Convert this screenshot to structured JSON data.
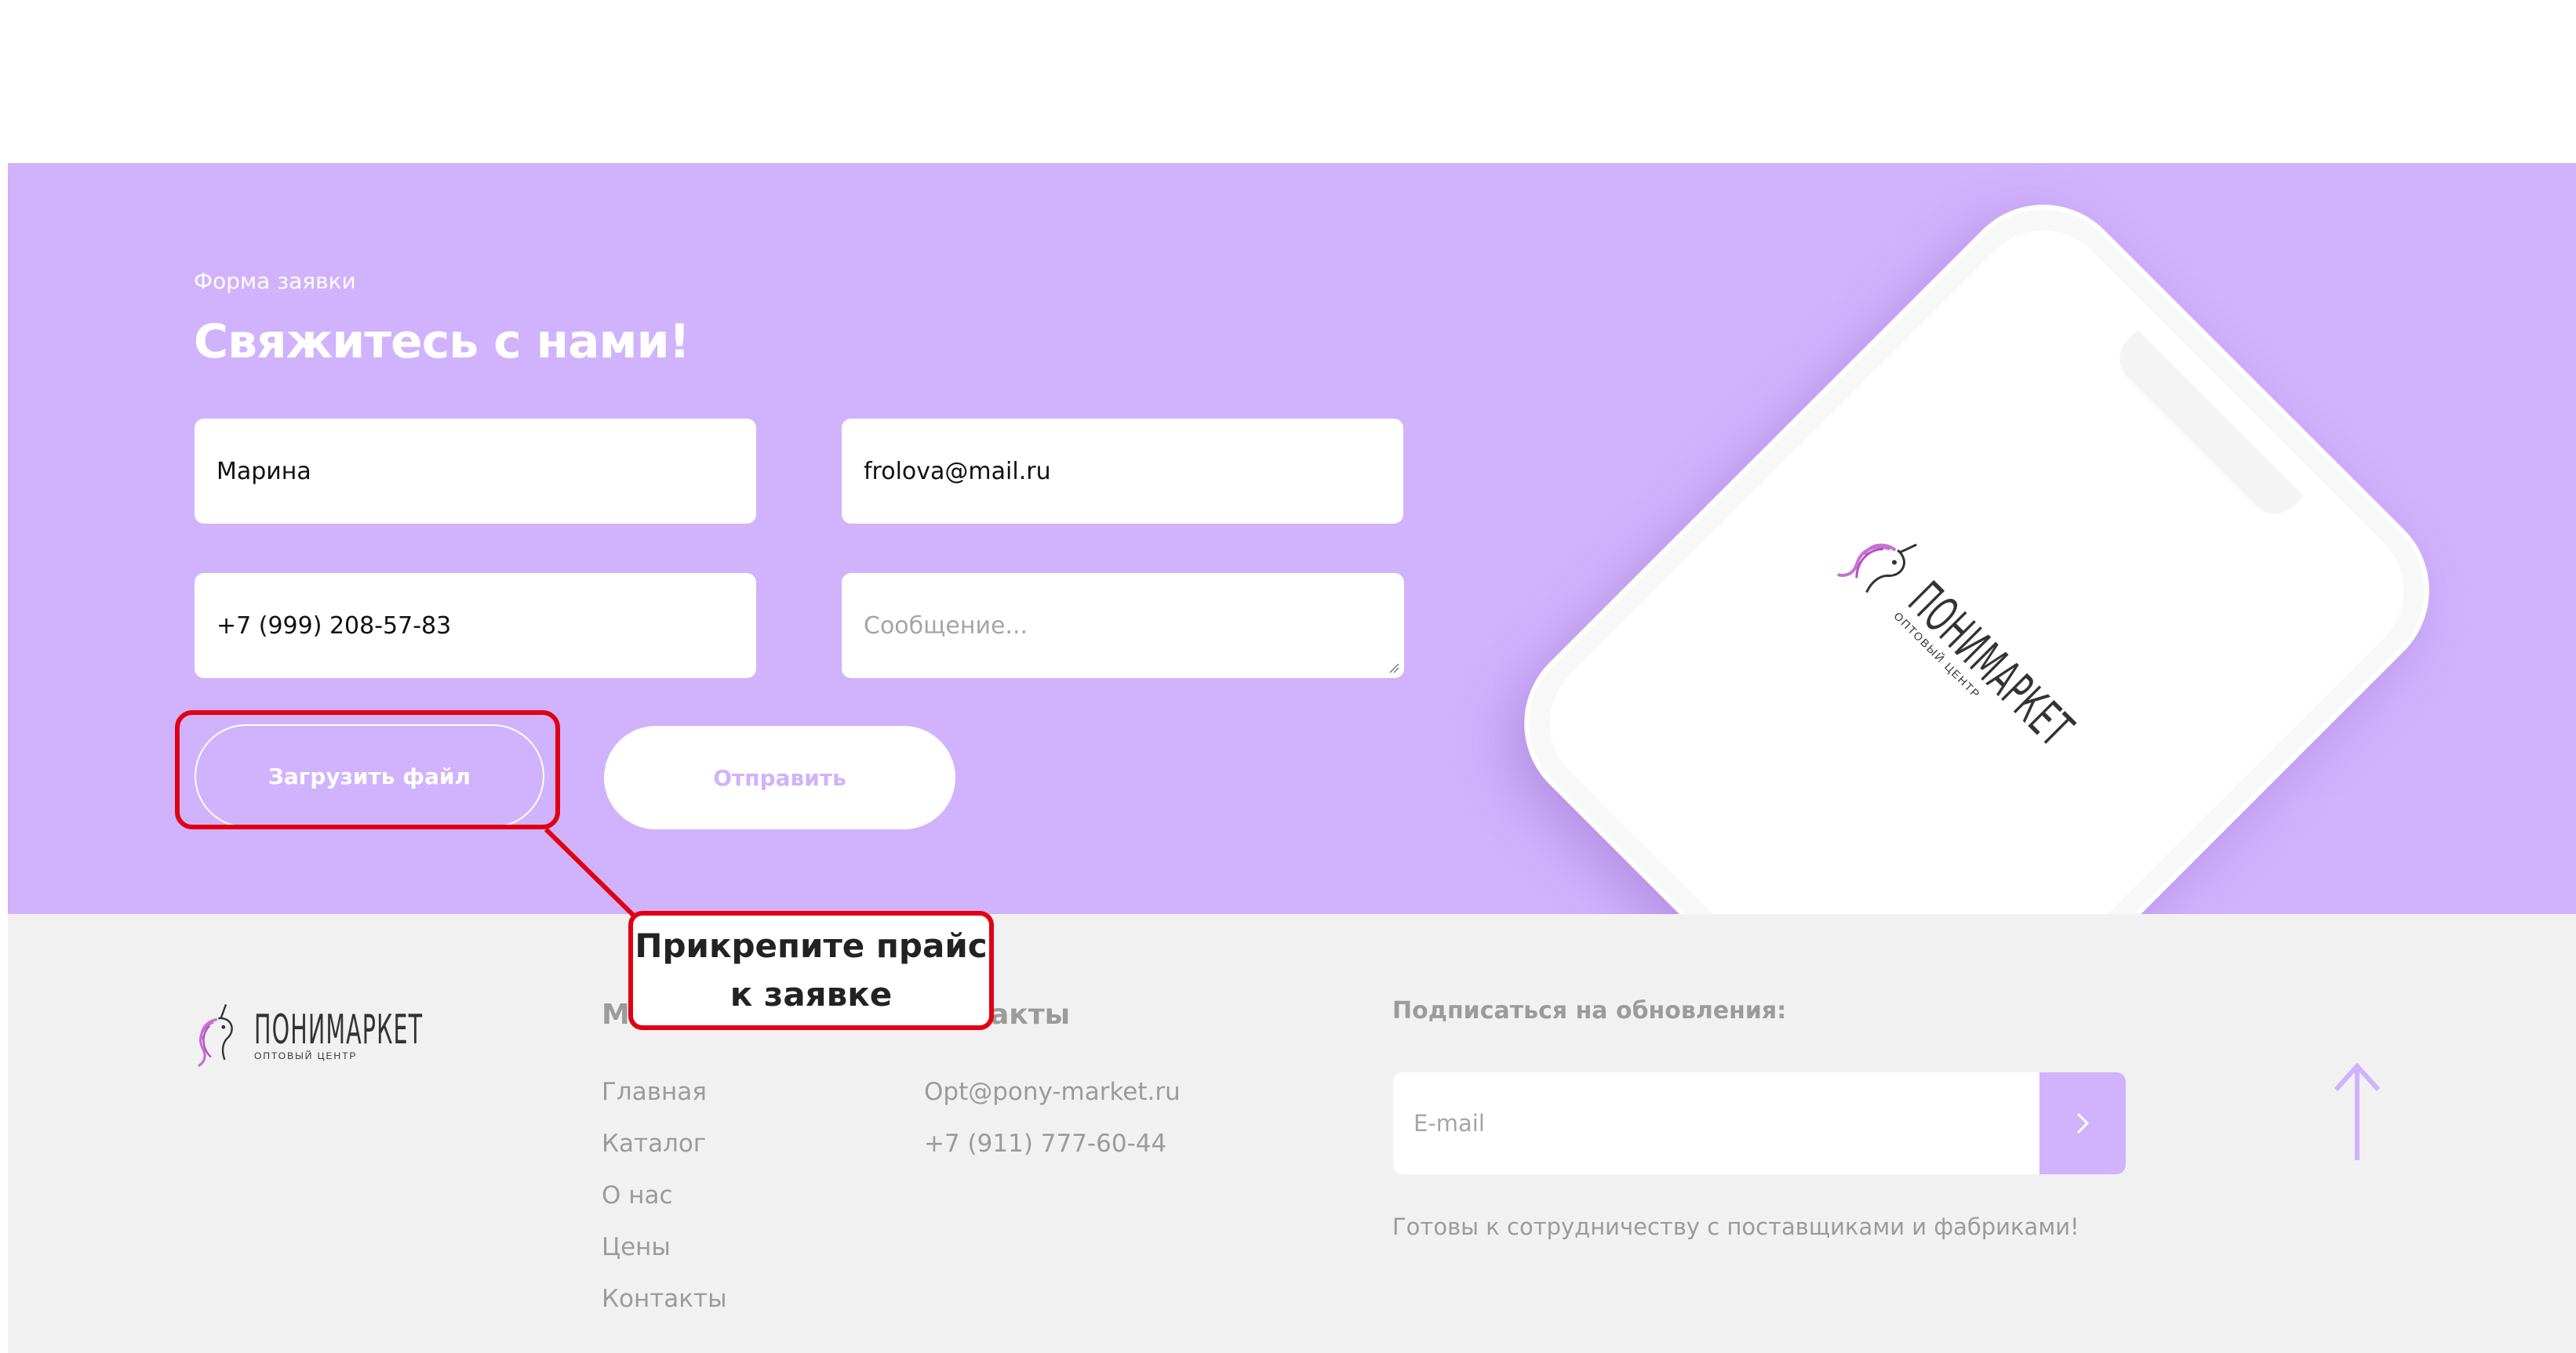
{
  "form": {
    "eyebrow": "Форма заявки",
    "title": "Свяжитесь с нами!",
    "name_value": "Марина",
    "email_value": "frolova@mail.ru",
    "phone_value": "+7 (999) 208-57-83",
    "message_placeholder": "Сообщение...",
    "upload_label": "Загрузить файл",
    "submit_label": "Отправить"
  },
  "phone_mockup": {
    "brand_name": "ПОНИМАРКЕТ",
    "brand_tagline": "ОПТОВЫЙ ЦЕНТР"
  },
  "callout": {
    "line1": "Прикрепите прайс",
    "line2": "к заявке",
    "color": "#e00012"
  },
  "footer": {
    "brand_name": "ПОНИМАРКЕТ",
    "brand_tagline": "ОПТОВЫЙ ЦЕНТР",
    "menu_heading": "М",
    "contacts_heading": "акты",
    "menu_items": [
      "Главная",
      "Каталог",
      "О нас",
      "Цены",
      "Контакты"
    ],
    "contacts": [
      "Opt@pony-market.ru",
      "+7 (911) 777-60-44"
    ],
    "subscribe_heading": "Подписаться на обновления:",
    "email_placeholder": "E-mail",
    "subscribe_note": "Готовы к сотрудничеству с поставщиками и фабриками!"
  },
  "icons": {
    "subscribe_arrow": "chevron-right-icon",
    "scroll_top": "arrow-up-icon",
    "logo": "unicorn-logo-icon"
  },
  "colors": {
    "accent": "#d1b2fc",
    "footer_bg": "#f1f1f1",
    "footer_text": "#9b9b9b"
  }
}
